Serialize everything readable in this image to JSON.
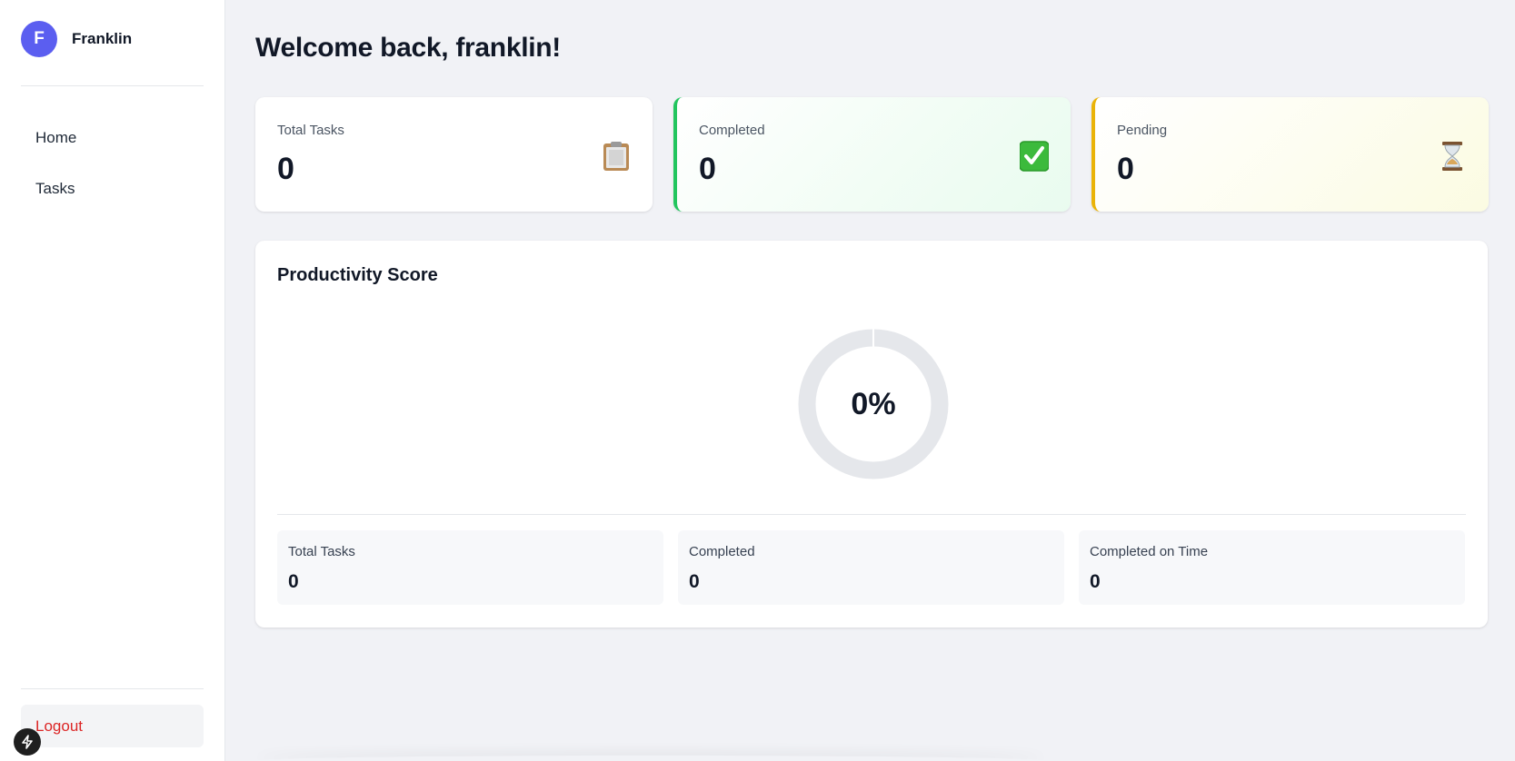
{
  "sidebar": {
    "avatar_initial": "F",
    "user_name": "Franklin",
    "nav": [
      {
        "label": "Home"
      },
      {
        "label": "Tasks"
      }
    ],
    "logout_label": "Logout"
  },
  "main": {
    "title": "Welcome back, franklin!",
    "stats": {
      "total": {
        "label": "Total Tasks",
        "value": "0",
        "icon": "clipboard-icon"
      },
      "completed": {
        "label": "Completed",
        "value": "0",
        "icon": "check-mark-icon",
        "accent": "#22c55e"
      },
      "pending": {
        "label": "Pending",
        "value": "0",
        "icon": "hourglass-icon",
        "accent": "#eab308"
      }
    },
    "productivity": {
      "title": "Productivity Score",
      "score_text": "0%",
      "score_fraction": 0,
      "cards": [
        {
          "label": "Total Tasks",
          "value": "0"
        },
        {
          "label": "Completed",
          "value": "0"
        },
        {
          "label": "Completed on Time",
          "value": "0"
        }
      ]
    }
  },
  "colors": {
    "avatar": "#5b5ef0",
    "logout": "#dc2626",
    "donut_track": "#e5e7eb"
  }
}
